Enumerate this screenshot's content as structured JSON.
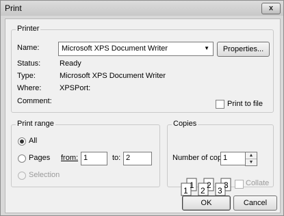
{
  "window": {
    "title": "Print",
    "close_label": "x"
  },
  "printer": {
    "group_label": "Printer",
    "name_label": "Name:",
    "name_value": "Microsoft XPS Document Writer",
    "properties_label": "Properties...",
    "status_label": "Status:",
    "status_value": "Ready",
    "type_label": "Type:",
    "type_value": "Microsoft XPS Document Writer",
    "where_label": "Where:",
    "where_value": "XPSPort:",
    "comment_label": "Comment:",
    "print_to_file_label": "Print to file"
  },
  "print_range": {
    "group_label": "Print range",
    "all_label": "All",
    "pages_label": "Pages",
    "from_label": "from:",
    "from_value": "1",
    "to_label": "to:",
    "to_value": "2",
    "selection_label": "Selection",
    "selected": "all"
  },
  "copies": {
    "group_label": "Copies",
    "number_label": "Number of copies:",
    "number_value": "1",
    "collate_label": "Collate",
    "collate_icon_digits": [
      "1",
      "1",
      "2",
      "2",
      "3",
      "3"
    ]
  },
  "buttons": {
    "ok": "OK",
    "cancel": "Cancel"
  }
}
